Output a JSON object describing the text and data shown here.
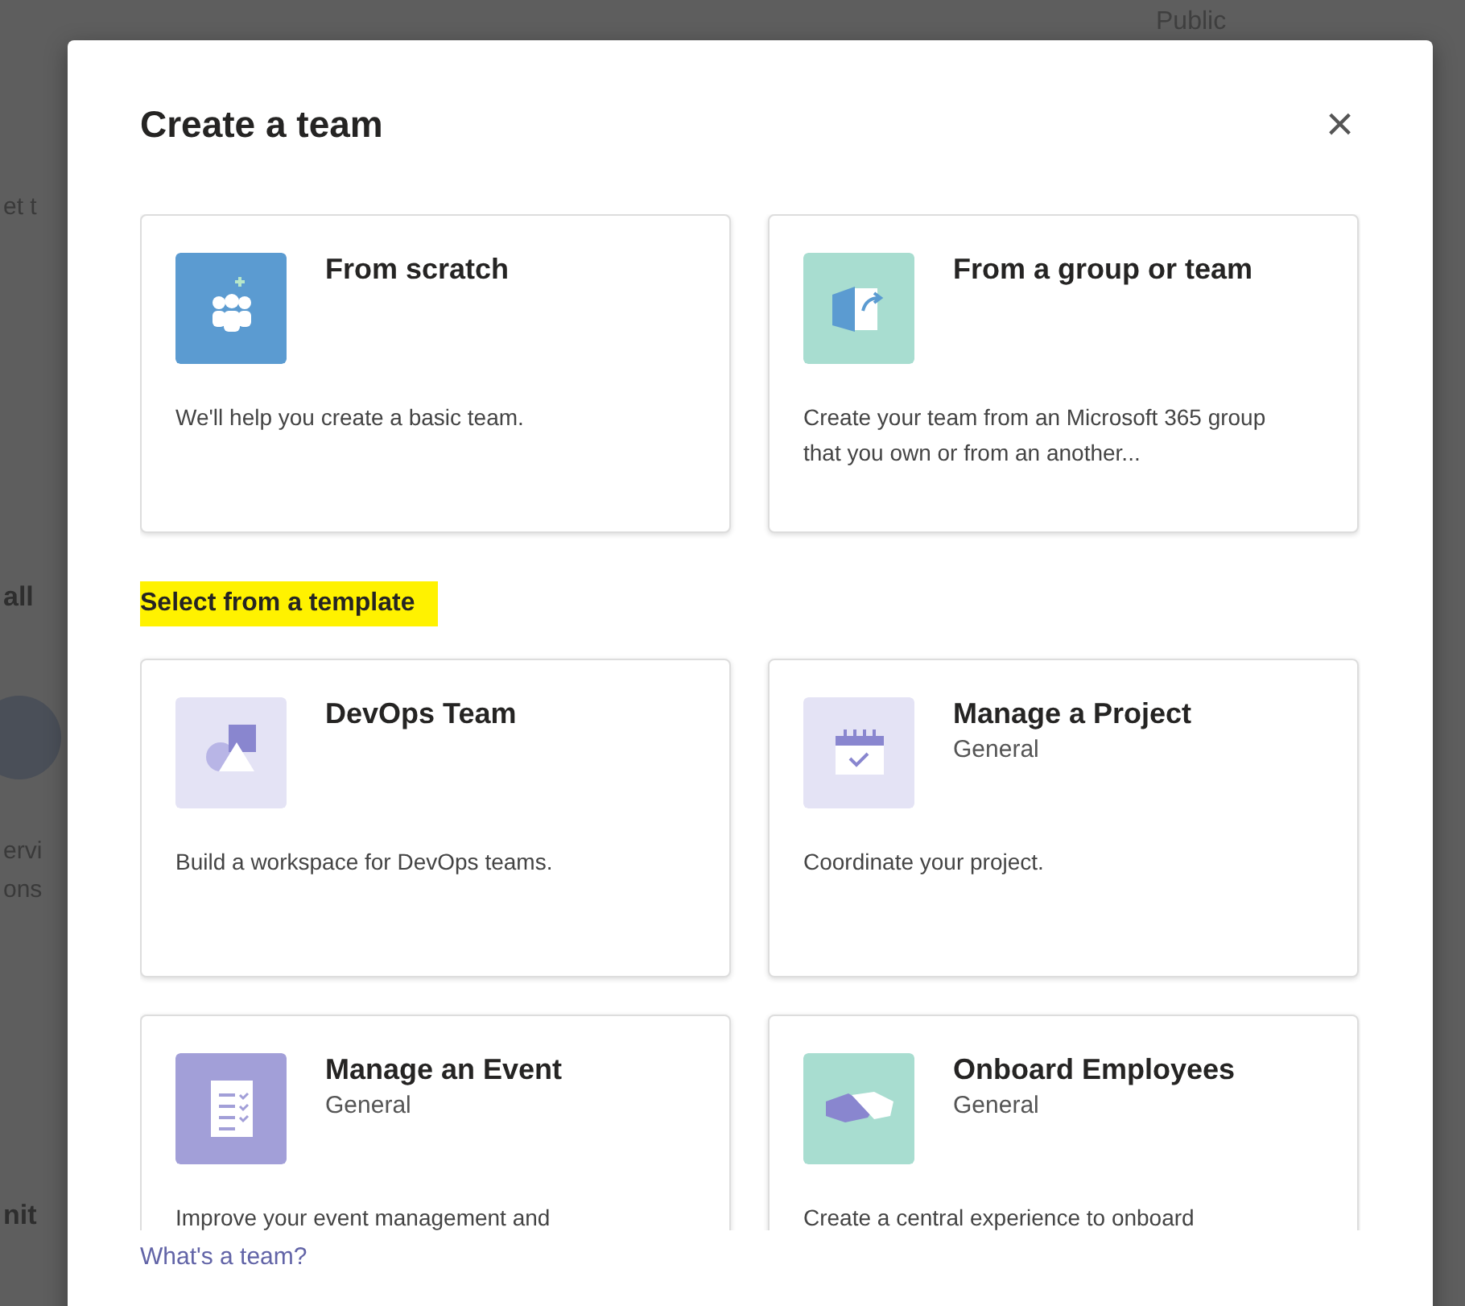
{
  "background": {
    "header_label": "Public",
    "side_texts": [
      "et t",
      "all",
      "ervi",
      "ons",
      "nit"
    ]
  },
  "dialog": {
    "title": "Create a team",
    "close": "×",
    "cards": [
      {
        "kind": "people",
        "color": "#5b9bd1",
        "title": "From scratch",
        "description": "We'll help you create a basic team."
      },
      {
        "kind": "group-arrow",
        "color": "#a8ddd0",
        "title": "From a group or team",
        "description": "Create your team from an Microsoft 365 group that you own or from an another..."
      }
    ],
    "section": {
      "label": "Select from a template",
      "highlighted": true
    },
    "templates": [
      {
        "kind": "shapes",
        "color": "#e4e3f5",
        "title": "DevOps Team",
        "description": "Build a workspace for DevOps teams."
      },
      {
        "kind": "calendar",
        "color": "#e4e3f5",
        "title": "Manage a Project",
        "subtitle": "General",
        "description": "Coordinate your project."
      },
      {
        "kind": "checklist",
        "color": "#a29fd8",
        "title": "Manage an Event",
        "subtitle": "General",
        "description": "Improve your event management and"
      },
      {
        "kind": "handshake",
        "color": "#a8ddd0",
        "title": "Onboard Employees",
        "subtitle": "General",
        "description": "Create a central experience to onboard"
      }
    ],
    "links": [
      "What's a team?"
    ]
  }
}
